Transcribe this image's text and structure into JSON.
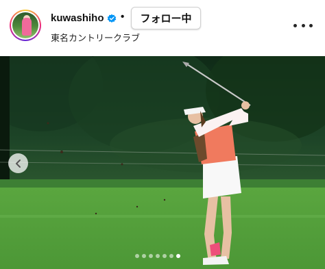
{
  "post": {
    "username": "kuwashiho",
    "separator": "•",
    "follow_label": "フォロー中",
    "location": "東名カントリークラブ",
    "verified": true
  },
  "icons": {
    "verified": "verified-badge-icon",
    "more": "more-options-icon",
    "prev": "chevron-left-icon"
  },
  "carousel": {
    "total": 7,
    "active_index": 6
  },
  "colors": {
    "verified_blue": "#0095f6",
    "text": "#111111",
    "fairway_green": "#5fa843",
    "shirt_salmon": "#f07a5e"
  }
}
